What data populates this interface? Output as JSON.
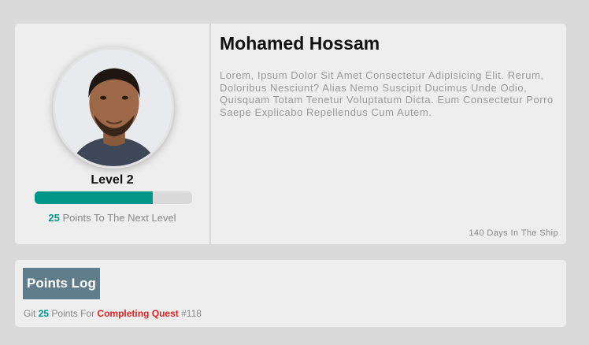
{
  "profile": {
    "name": "Mohamed Hossam",
    "level_label": "Level 2",
    "progress_fraction": 0.75,
    "points_to_next": "25",
    "points_to_next_suffix": "Points To The Next Level",
    "bio": "Lorem, Ipsum Dolor Sit Amet Consectetur Adipisicing Elit. Rerum, Doloribus Nesciunt? Alias Nemo Suscipit Ducimus Unde Odio, Quisquam Totam Tenetur Voluptatum Dicta. Eum Consectetur Porro Saepe Explicabo Repellendus Cum Autem.",
    "days_in_ship": "140 Days In The Ship"
  },
  "points_log": {
    "title": "Points Log",
    "entry": {
      "prefix": "Git",
      "points": "25",
      "middle": "Points For",
      "link": "Completing Quest",
      "suffix": "#118"
    }
  },
  "colors": {
    "accent": "#009688",
    "header_bg": "#607d8b",
    "link": "#e52121"
  }
}
